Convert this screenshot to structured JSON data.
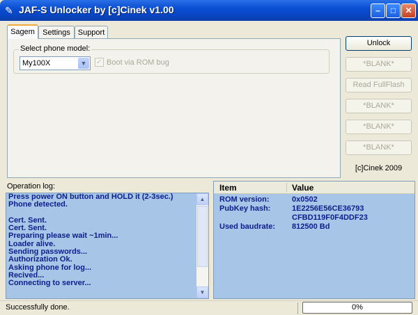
{
  "window": {
    "title": "JAF-S Unlocker by [c]Cinek v1.00",
    "icons": {
      "app": "wrench-icon",
      "minimize": "minimize-icon",
      "maximize": "maximize-icon",
      "close": "close-icon"
    }
  },
  "tabs": [
    {
      "label": "Sagem",
      "active": true
    },
    {
      "label": "Settings",
      "active": false
    },
    {
      "label": "Support",
      "active": false
    }
  ],
  "sagem": {
    "group_label": "Select phone model:",
    "model_value": "My100X",
    "boot_checkbox_label": "Boot via ROM bug",
    "boot_checked": true,
    "boot_enabled": false
  },
  "buttons": [
    {
      "label": "Unlock",
      "enabled": true
    },
    {
      "label": "*BLANK*",
      "enabled": false
    },
    {
      "label": "Read FullFlash",
      "enabled": false
    },
    {
      "label": "*BLANK*",
      "enabled": false
    },
    {
      "label": "*BLANK*",
      "enabled": false
    },
    {
      "label": "*BLANK*",
      "enabled": false
    }
  ],
  "credit": "[c]Cinek 2009",
  "log": {
    "label": "Operation log:",
    "lines": [
      "Press power ON button and HOLD it (2-3sec.)",
      "Phone detected.",
      "",
      "Cert. Sent.",
      "Cert. Sent.",
      "Preparing please wait ~1min...",
      "Loader alive.",
      "Sending passwords...",
      "Authorization Ok.",
      "Asking phone for log...",
      "Recived...",
      "Connecting to server..."
    ]
  },
  "info": {
    "headers": [
      "Item",
      "Value"
    ],
    "rows": [
      {
        "item": "ROM version:",
        "value": "0x0502"
      },
      {
        "item": "PubKey hash:",
        "value": "1E2256E56CE36793"
      },
      {
        "item": "",
        "value": "CFBD119F0F4DDF23"
      },
      {
        "item": "Used baudrate:",
        "value": "812500 Bd"
      }
    ]
  },
  "status": {
    "text": "Successfully done.",
    "progress_text": "0%",
    "progress_value": 0
  },
  "colors": {
    "log_background": "#a7c5e6",
    "log_text": "#0b1f8c",
    "title_bar": "#0a4fd4"
  }
}
